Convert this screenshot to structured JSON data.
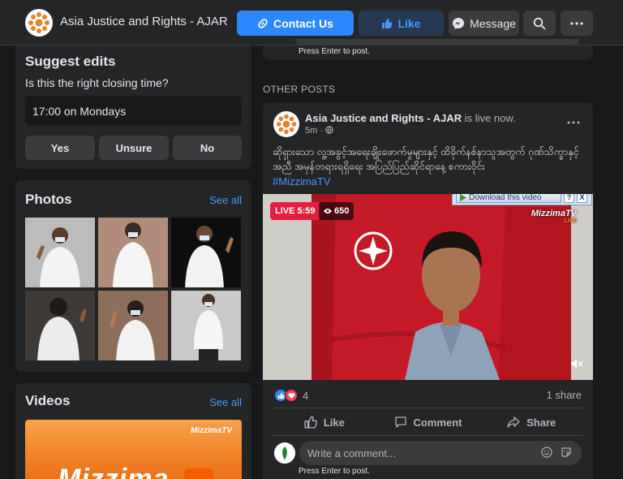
{
  "header": {
    "page_name": "Asia Justice and Rights - AJAR",
    "contact_label": "Contact Us",
    "like_label": "Like",
    "message_label": "Message"
  },
  "suggest_edits": {
    "title": "Suggest edits",
    "question": "Is this the right closing time?",
    "time_value": "17:00 on Mondays",
    "options": [
      "Yes",
      "Unsure",
      "No"
    ]
  },
  "photos": {
    "title": "Photos",
    "see_all": "See all"
  },
  "videos": {
    "title": "Videos",
    "see_all": "See all",
    "thumb_brand": "MizzimaTV",
    "thumb_text": "Mizzima"
  },
  "previous_post": {
    "press_enter": "Press Enter to post."
  },
  "section_label": "OTHER POSTS",
  "post": {
    "author": "Asia Justice and Rights - AJAR",
    "status": "is live now.",
    "time": "5m",
    "text": "ဆိုရှားသော လူ့အခွင့်အရေးချိုးဖောက်မှုများနှင့် ထိခိုက်နစ်နာသူအတွက် ဂုဏ်သိက္ခာနှင့်အညီ အမှန်တရားရရှိရေး အပြည်ပြည်ဆိုင်ရာနေ့ စကားဝိုင်း",
    "hashtag": "#MizzimaTV",
    "live_badge": "LIVE 5:59",
    "viewers": "650",
    "download_label": "Download this video",
    "download_help": "?",
    "download_close": "X",
    "video_brand": "MizzimaTV",
    "video_brand_sub": "LIVE",
    "reaction_count": "4",
    "shares": "1 share",
    "like_action": "Like",
    "comment_action": "Comment",
    "share_action": "Share",
    "comment_placeholder": "Write a comment...",
    "press_enter": "Press Enter to post."
  },
  "colors": {
    "background": "#18191a",
    "card": "#242526",
    "accent": "#2d88ff",
    "live_red": "#e41e3f"
  }
}
